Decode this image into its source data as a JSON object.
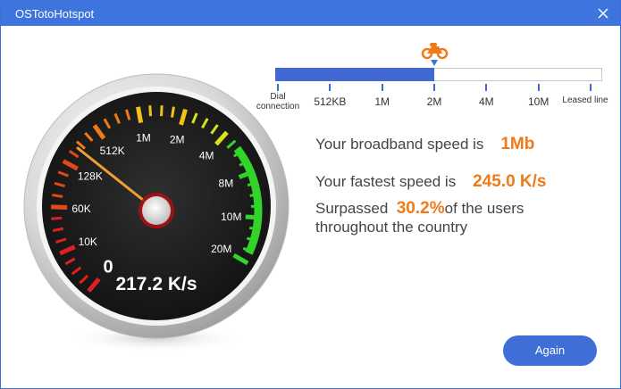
{
  "window": {
    "title": "OSTotoHotspot"
  },
  "gauge": {
    "labels": [
      "0",
      "10K",
      "60K",
      "128K",
      "512K",
      "1M",
      "2M",
      "4M",
      "8M",
      "10M",
      "20M"
    ],
    "reading": "217.2 K/s"
  },
  "scale": {
    "labels": [
      "Dial connection",
      "512KB",
      "1M",
      "2M",
      "4M",
      "10M",
      "Leased line"
    ],
    "marker_index": 3
  },
  "info": {
    "broadband_prefix": "Your broadband speed is",
    "broadband_value": "1Mb",
    "fastest_prefix": "Your fastest speed is",
    "fastest_value": "245.0 K/s",
    "surpassed_prefix": "Surpassed",
    "surpassed_value": "30.2%",
    "surpassed_suffix": "of the users",
    "surpassed_line2": "throughout the country"
  },
  "buttons": {
    "again": "Again"
  },
  "colors": {
    "accent": "#3e74dd",
    "highlight": "#f07a18",
    "needle": "#f0a030"
  }
}
